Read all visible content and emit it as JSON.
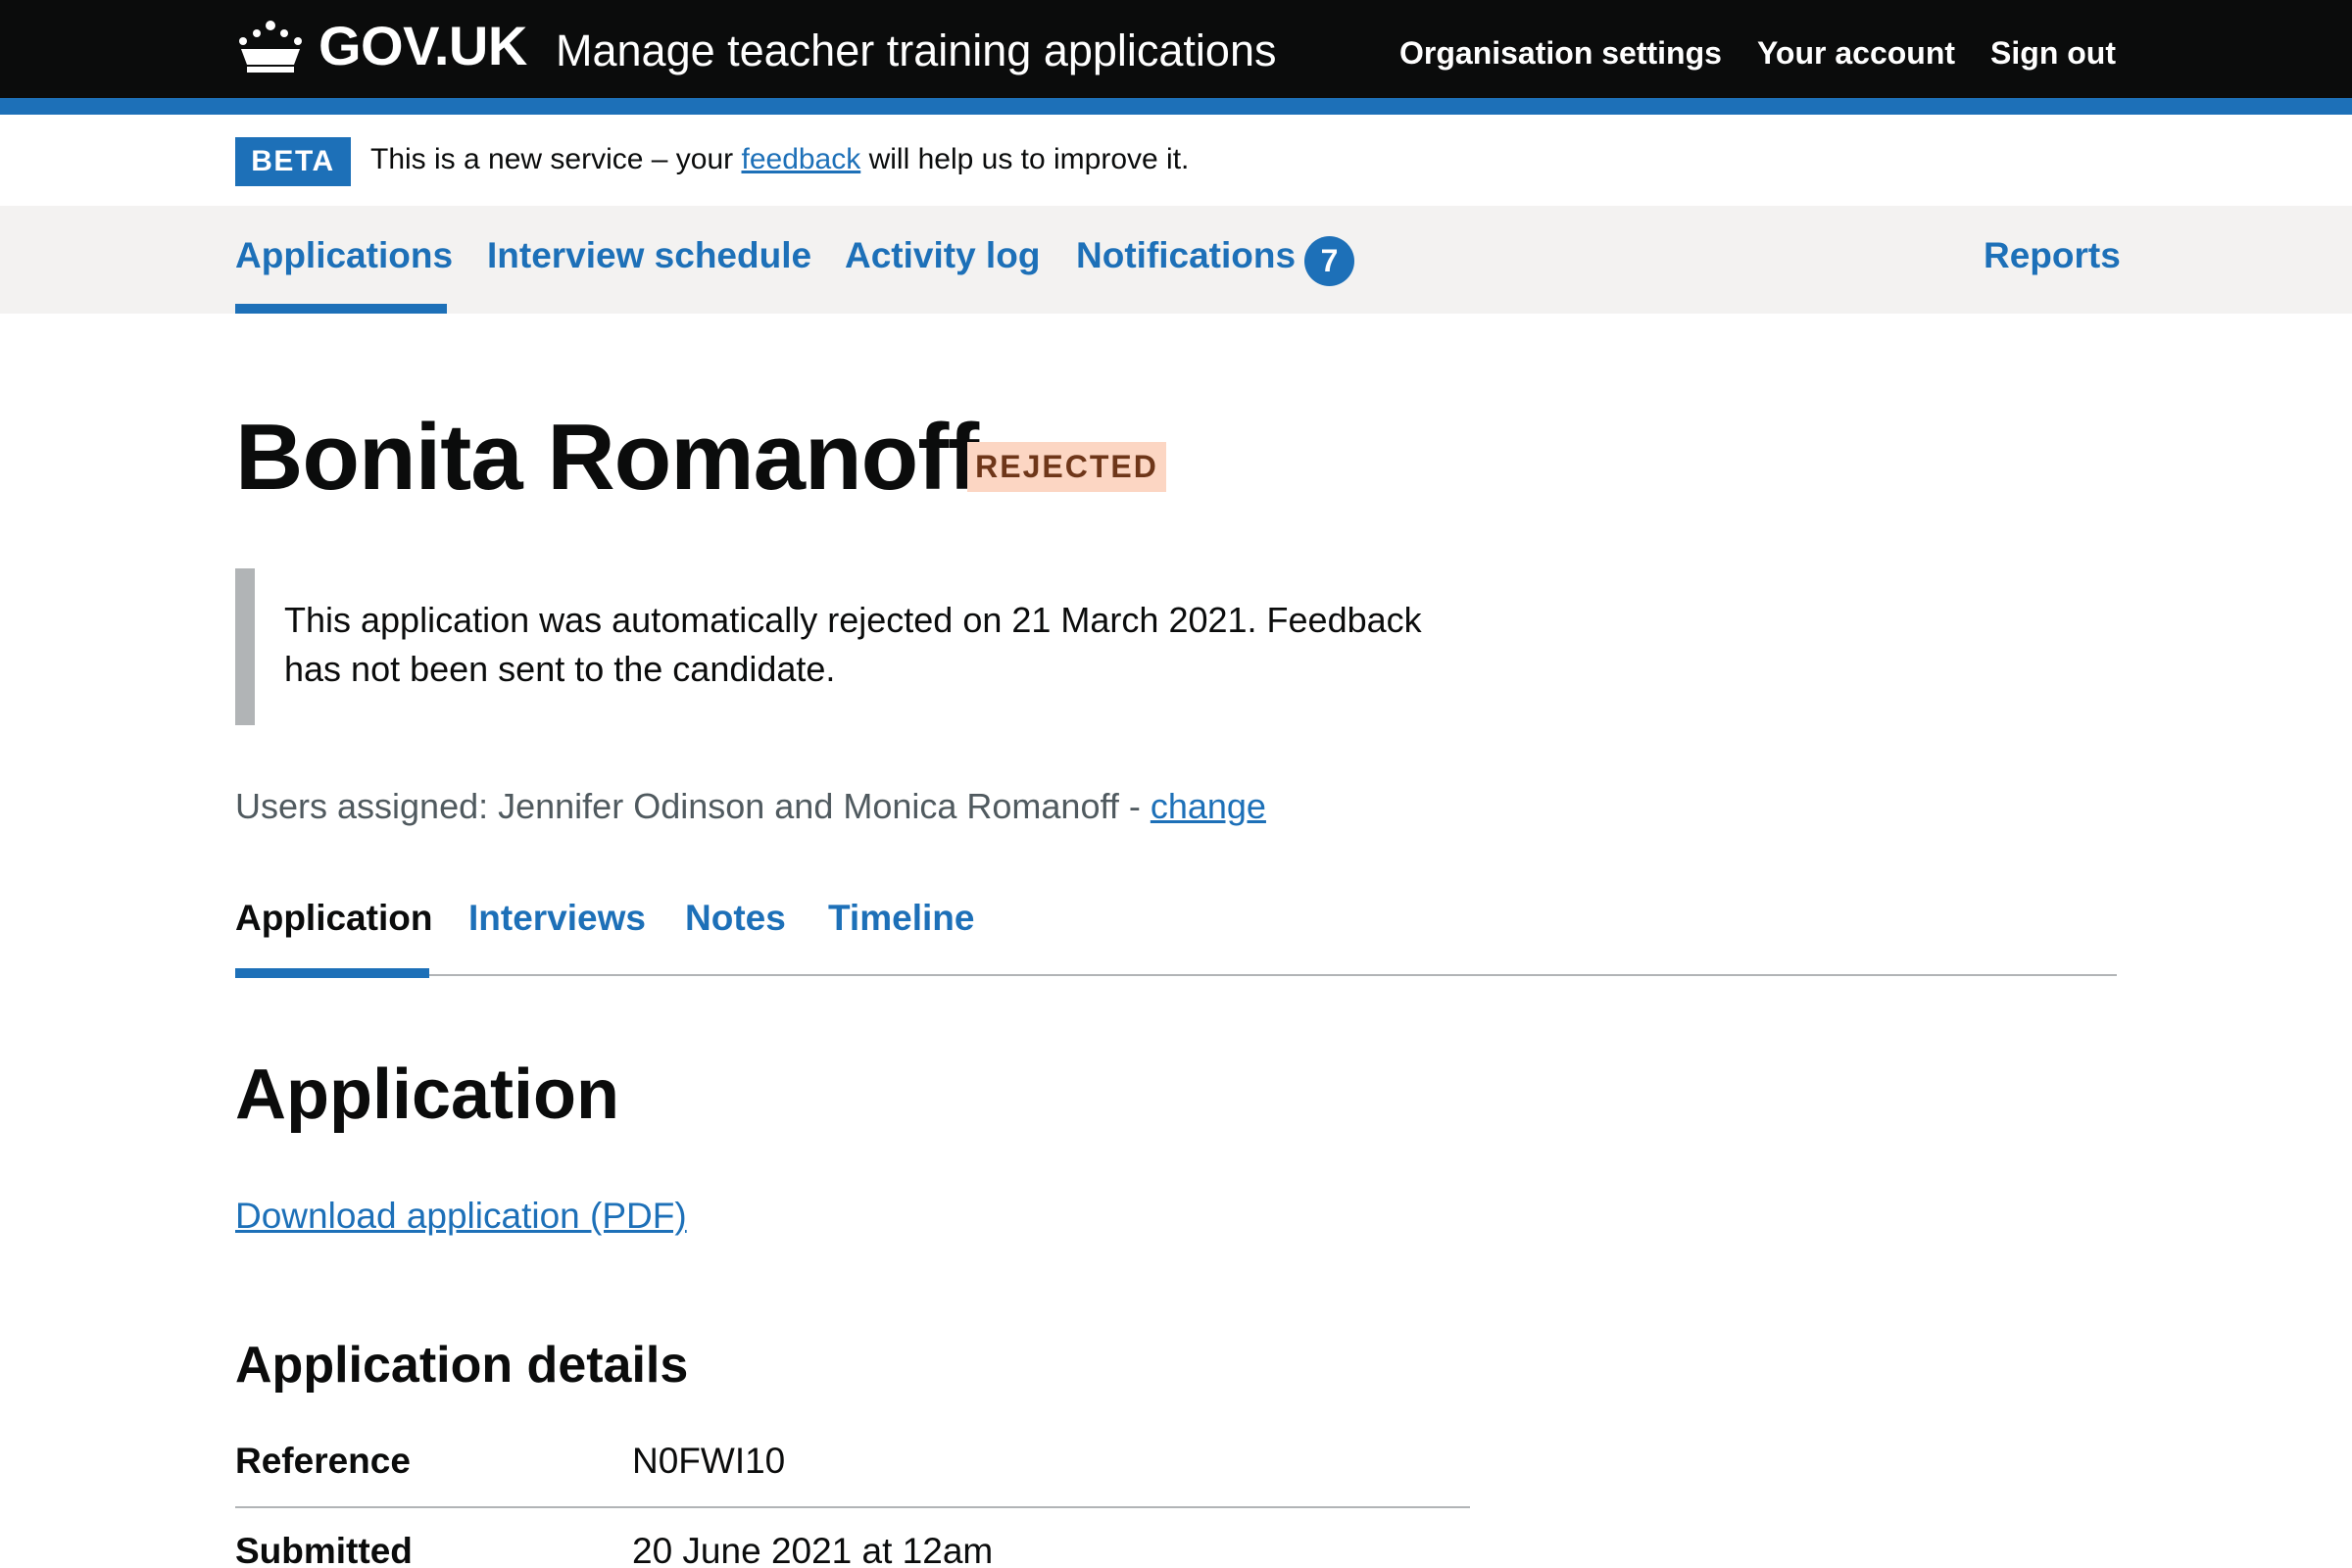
{
  "header": {
    "logo_text": "GOV.UK",
    "service_name": "Manage teacher training applications",
    "nav": [
      "Organisation settings",
      "Your account",
      "Sign out"
    ]
  },
  "phase_banner": {
    "tag": "BETA",
    "text_before": "This is a new service – your ",
    "link": "feedback",
    "text_after": " will help us to improve it."
  },
  "primary_nav": {
    "items": [
      "Applications",
      "Interview schedule",
      "Activity log",
      "Notifications",
      "Reports"
    ],
    "active": "Applications",
    "notifications_count": "7"
  },
  "candidate": {
    "name": "Bonita Romanoff",
    "status": "REJECTED"
  },
  "inset": {
    "text": "This application was automatically rejected on 21 March 2021. Feedback has not been sent to the candidate."
  },
  "assigned": {
    "text": "Users assigned: Jennifer Odinson and Monica Romanoff - ",
    "link": "change"
  },
  "tabs": {
    "items": [
      "Application",
      "Interviews",
      "Notes",
      "Timeline"
    ],
    "active": "Application"
  },
  "section": {
    "title": "Application",
    "download_link": "Download application (PDF)"
  },
  "details": {
    "title": "Application details",
    "rows": [
      {
        "key": "Reference",
        "value": "N0FWI10"
      },
      {
        "key": "Submitted",
        "value": "20 June 2021 at 12am"
      }
    ]
  },
  "colors": {
    "header_bg": "#0b0c0c",
    "brand_blue": "#1d70b8",
    "nav_bg": "#f3f2f1",
    "rejected_tag_bg": "#fcd6c3",
    "rejected_tag_text": "#6e3619",
    "inset_border": "#b1b4b6"
  }
}
